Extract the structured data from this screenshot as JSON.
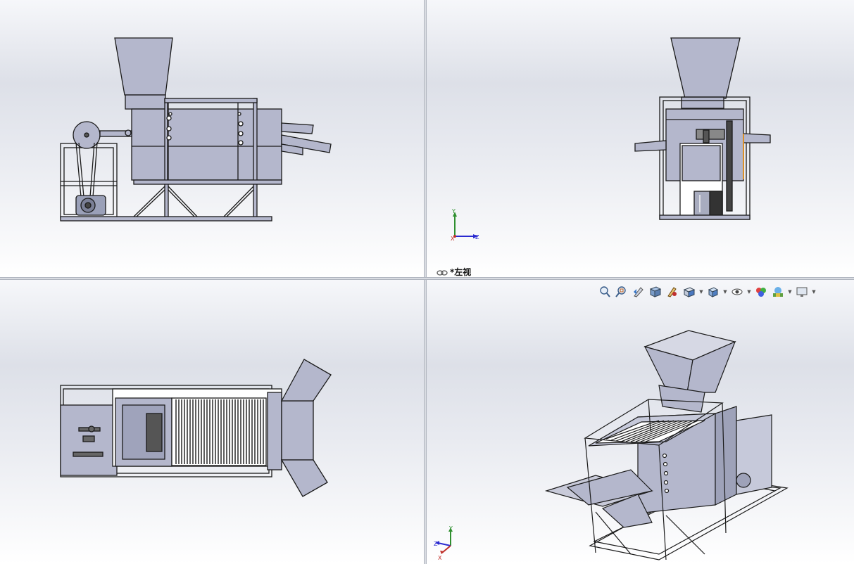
{
  "viewports": {
    "top_left": {
      "name": "front"
    },
    "top_right": {
      "name": "left",
      "label": "*左视"
    },
    "bottom_left": {
      "name": "top"
    },
    "bottom_right": {
      "name": "isometric"
    }
  },
  "triad": {
    "x": "X",
    "y": "Y",
    "z": "Z"
  },
  "toolbar": {
    "items": [
      {
        "icon": "zoom-to-fit-icon",
        "has_menu": false
      },
      {
        "icon": "zoom-to-area-icon",
        "has_menu": false
      },
      {
        "icon": "previous-view-icon",
        "has_menu": false
      },
      {
        "icon": "section-view-icon",
        "has_menu": false
      },
      {
        "icon": "dynamic-annotation-icon",
        "has_menu": false
      },
      {
        "icon": "view-orientation-icon",
        "has_menu": true
      },
      {
        "icon": "display-style-icon",
        "has_menu": true
      },
      {
        "icon": "hide-show-items-icon",
        "has_menu": true
      },
      {
        "icon": "edit-appearance-icon",
        "has_menu": false
      },
      {
        "icon": "apply-scene-icon",
        "has_menu": true
      },
      {
        "icon": "view-settings-icon",
        "has_menu": true
      }
    ]
  },
  "colors": {
    "part_fill": "#b4b7cc",
    "part_dark": "#8f93aa",
    "edge": "#1a1a1a",
    "axis_x": "#c0302a",
    "axis_y": "#2f8f2f",
    "axis_z": "#2a2ad0"
  }
}
